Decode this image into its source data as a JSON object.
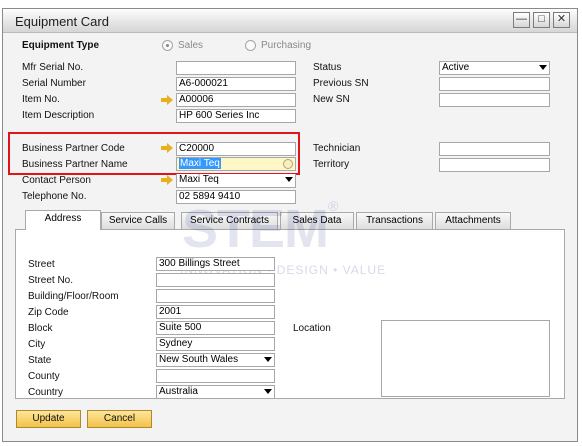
{
  "window": {
    "title": "Equipment Card"
  },
  "equipment_type": {
    "label": "Equipment Type",
    "options": [
      "Sales",
      "Purchasing"
    ],
    "selected": "Sales"
  },
  "left_fields": {
    "mfr_serial_label": "Mfr Serial No.",
    "mfr_serial_value": "",
    "serial_label": "Serial Number",
    "serial_value": "A6-000021",
    "item_no_label": "Item No.",
    "item_no_value": "A00006",
    "item_desc_label": "Item Description",
    "item_desc_value": "HP 600 Series Inc",
    "bp_code_label": "Business Partner Code",
    "bp_code_value": "C20000",
    "bp_name_label": "Business Partner Name",
    "bp_name_value": "Maxi Teq",
    "contact_label": "Contact Person",
    "contact_value": "Maxi Teq",
    "phone_label": "Telephone No.",
    "phone_value": "02 5894 9410"
  },
  "right_fields": {
    "status_label": "Status",
    "status_value": "Active",
    "prev_sn_label": "Previous SN",
    "prev_sn_value": "",
    "new_sn_label": "New SN",
    "new_sn_value": "",
    "technician_label": "Technician",
    "technician_value": "",
    "territory_label": "Territory",
    "territory_value": ""
  },
  "tabs": [
    "Address",
    "Service Calls",
    "Service Contracts",
    "Sales Data",
    "Transactions",
    "Attachments"
  ],
  "address": {
    "street_label": "Street",
    "street_value": "300 Billings Street",
    "street_no_label": "Street No.",
    "street_no_value": "",
    "building_label": "Building/Floor/Room",
    "building_value": "",
    "zip_label": "Zip Code",
    "zip_value": "2001",
    "block_label": "Block",
    "block_value": "Suite 500",
    "city_label": "City",
    "city_value": "Sydney",
    "state_label": "State",
    "state_value": "New South Wales",
    "county_label": "County",
    "county_value": "",
    "country_label": "Country",
    "country_value": "Australia",
    "location_label": "Location",
    "location_value": ""
  },
  "watermark": {
    "brand": "STEM",
    "tagline": "INNOVATION • DESIGN • VALUE"
  },
  "buttons": {
    "update": "Update",
    "cancel": "Cancel"
  },
  "colors": {
    "highlight_box": "#e0151b",
    "button_fill": "#f3c24b",
    "link_arrow": "#e8b020",
    "selection": "#3399ff"
  }
}
